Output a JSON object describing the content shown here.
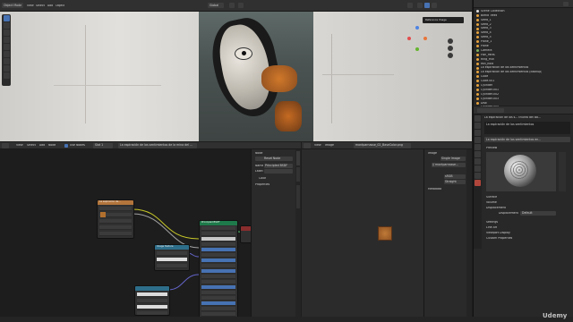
{
  "viewport": {
    "mode": "Object Mode",
    "menu": [
      "View",
      "Select",
      "Add",
      "Object"
    ],
    "transform": "Global",
    "options": "Options",
    "overlay": "Reference Image"
  },
  "outliner": {
    "items": [
      "Scene Collection",
      "Blend Trees",
      "Seed_1",
      "Seed_2",
      "Seed_3",
      "Seed_4",
      "Seed_5",
      "Plane_1",
      "Plane",
      "Camera",
      "Fish_Parts",
      "Ring_Fish",
      "fish_hold",
      "La espiración de los sentimientos",
      "La espiración de los sentimientos (Backup)",
      "Cube",
      "Cube.001",
      "Cylinder",
      "Cylinder.001",
      "Cylinder.002",
      "Cylinder.003",
      "Disk",
      "Cylinder.004",
      "FloodlightBase",
      "Ground Color"
    ]
  },
  "properties": {
    "breadcrumb_1": "La espiración de los s... triunfo del Ba...",
    "breadcrumb_2": "La espiración de los sentimientos",
    "material_name": "La espiración de los sentimientos en...",
    "sections": [
      "Preview",
      "Surface",
      "Volume",
      "Displacement",
      "Settings",
      "Line Art",
      "Viewport Display",
      "Custom Properties"
    ],
    "displacement_label": "Displacement",
    "displacement_value": "Default"
  },
  "node_editor": {
    "menu": [
      "View",
      "Select",
      "Add",
      "Node"
    ],
    "use_nodes": "Use Nodes",
    "slot": "Slot 1",
    "material": "La espiración de los sentimientos de la mina del ...",
    "breadcrumb": "La espiración de los sentimientos de la mina del ...",
    "sidebar": {
      "title": "Node",
      "name_label": "Name",
      "name_value": "Principled BSDF",
      "label_label": "Label",
      "color_label": "Color",
      "properties_label": "Properties",
      "reset_node": "Reset Node"
    },
    "node_texture": "La espiración de...",
    "node_bsdf": "Principled BSDF",
    "node_output": "Material Output",
    "node_mapping": "Image Texture"
  },
  "image_editor": {
    "menu": [
      "View",
      "Image"
    ],
    "image_name": "montparnasse_02_BaseColor.png",
    "panel": {
      "title": "Image",
      "source": "Single Image",
      "file": "// montparnasse...",
      "color_space": "sRGB",
      "alpha": "Straight",
      "metadata": "Metadata"
    }
  },
  "watermark": "Udemy",
  "colors": {
    "accent_blue": "#4772b3",
    "node_texture_header": "#b3753c",
    "node_bsdf_header": "#1e7a4a",
    "node_mapping_header": "#2d6e8a",
    "link_yellow": "#c7c729"
  }
}
